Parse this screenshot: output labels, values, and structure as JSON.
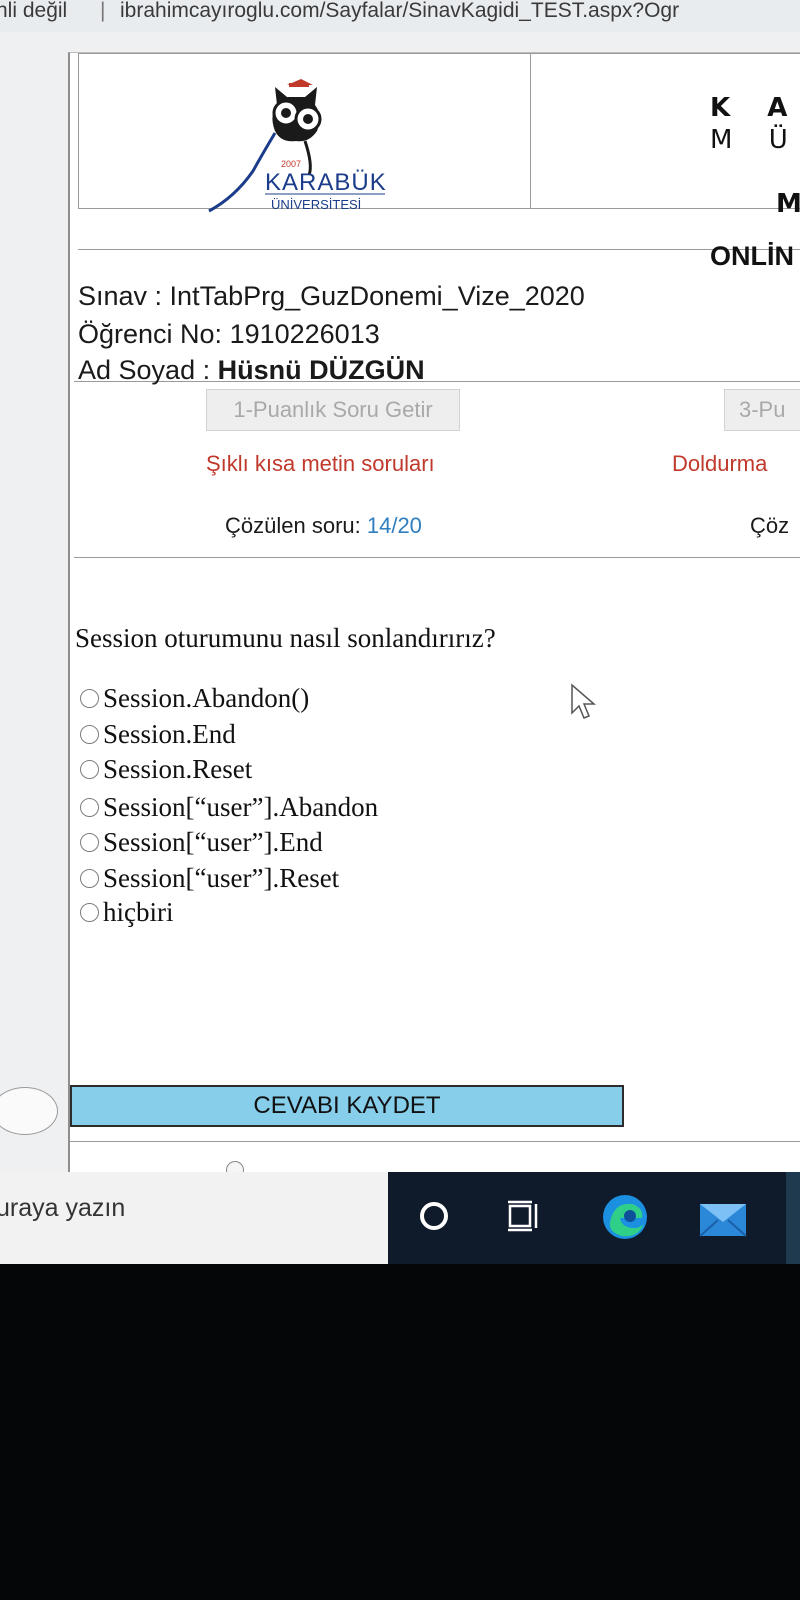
{
  "browser": {
    "security_text": "nli değil",
    "separator": "|",
    "url": "ibrahimcayıroglu.com/Sayfalar/SinavKagidi_TEST.aspx?Ogr"
  },
  "header": {
    "logo": {
      "year": "2007",
      "name": "KARABÜK",
      "sub": "ÜNİVERSİTESİ"
    },
    "right_line1": "K A",
    "right_line2": "M Ü",
    "right_line3": "M",
    "banner": "ONLİN"
  },
  "exam_info": {
    "exam_label": "Sınav : ",
    "exam_value": "IntTabPrg_GuzDonemi_Vize_2020",
    "student_no_label": "Öğrenci No: ",
    "student_no_value": "1910226013",
    "name_label": "Ad Soyad : ",
    "name_value": "Hüsnü DÜZGÜN"
  },
  "toolbar": {
    "btn1_label": "1-Puanlık Soru Getir",
    "btn3_label": "3-Pu",
    "category_left": "Şıklı kısa metin soruları",
    "category_right": "Doldurma",
    "solved_label": "Çözülen soru: ",
    "solved_value": "14/20",
    "solved_right": "Çöz"
  },
  "question": {
    "text": "Session oturumunu nasıl sonlandırırız?",
    "options": [
      "Session.Abandon()",
      "Session.End",
      "Session.Reset",
      "Session[“user”].Abandon",
      "Session[“user”].End",
      "Session[“user”].Reset",
      "hiçbiri"
    ]
  },
  "save_button_label": "CEVABI KAYDET",
  "taskbar": {
    "search_text": "uraya yazın",
    "icons": [
      "cortana-circle-icon",
      "task-view-icon",
      "edge-icon",
      "mail-icon"
    ]
  },
  "colors": {
    "save_button": "#87ceeb",
    "category_red": "#c0392b",
    "counter_blue": "#2f7fc0"
  }
}
